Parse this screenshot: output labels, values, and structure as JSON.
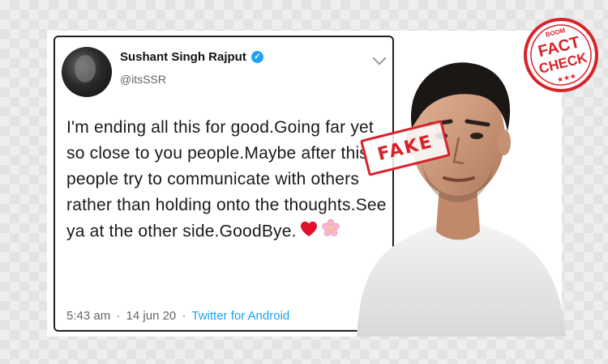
{
  "tweet": {
    "author_name": "Sushant Singh Rajput",
    "handle": "@itsSSR",
    "text": "I'm ending all this for good.Going far yet so close to you people.Maybe after this people try to communicate with others rather than holding onto the thoughts.See ya at the other side.GoodBye.",
    "time": "5:43 am",
    "date": "14 jun 20",
    "separator": "·",
    "source": "Twitter for Android",
    "emojis": [
      "heart-icon",
      "flower-icon"
    ]
  },
  "stamp": {
    "label": "FAKE"
  },
  "seal": {
    "brand": "BOOM",
    "line1": "FACT",
    "line2": "CHECK",
    "stars": "★★★"
  },
  "colors": {
    "stamp_red": "#d8232a",
    "link_blue": "#1da1f2",
    "heart_red": "#e0102a"
  }
}
